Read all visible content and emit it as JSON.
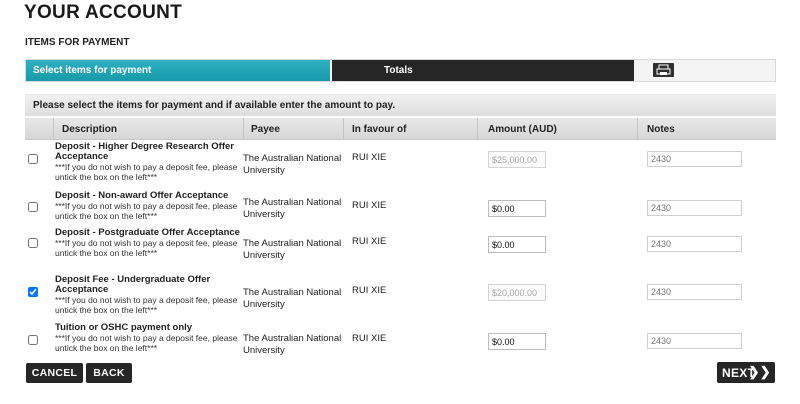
{
  "page": {
    "title": "YOUR ACCOUNT",
    "section_title": "ITEMS FOR PAYMENT"
  },
  "steps": {
    "select_label": "Select items for payment",
    "totals_label": "Totals",
    "print_icon": "printer-icon"
  },
  "instruction": "Please select the items for payment and if available enter the amount to pay.",
  "table": {
    "headers": {
      "description": "Description",
      "payee": "Payee",
      "favour": "In favour of",
      "amount": "Amount (AUD)",
      "notes": "Notes"
    },
    "rows": [
      {
        "checked": false,
        "title": "Deposit - Higher Degree Research Offer Acceptance",
        "note": "***If you do not wish to pay a deposit fee, please untick the box on the left***",
        "payee": "The Australian National University",
        "favour": "RUI XIE",
        "amount": "$25,000.00",
        "amount_editable": false,
        "notes": "2430"
      },
      {
        "checked": false,
        "title": "Deposit - Non-award Offer Acceptance",
        "note": "***If you do not wish to pay a deposit fee, please untick the box on the left***",
        "payee": "The Australian National University",
        "favour": "RUI XIE",
        "amount": "$0.00",
        "amount_editable": true,
        "notes": "2430"
      },
      {
        "checked": false,
        "title": "Deposit - Postgraduate Offer Acceptance",
        "note": "***If you do not wish to pay a deposit fee, please untick the box on the left***",
        "payee": "The Australian National University",
        "favour": "RUI XIE",
        "amount": "$0.00",
        "amount_editable": true,
        "notes": "2430"
      },
      {
        "checked": true,
        "title": "Deposit Fee - Undergraduate Offer Acceptance",
        "note": "***If you do not wish to pay a deposit fee, please untick the box on the left***",
        "payee": "The Australian National University",
        "favour": "RUI XIE",
        "amount": "$20,000.00",
        "amount_editable": false,
        "notes": "2430"
      },
      {
        "checked": false,
        "title": "Tuition or OSHC payment only",
        "note": "***If you do not wish to pay a deposit fee, please untick the box on the left***",
        "payee": "The Australian National University",
        "favour": "RUI XIE",
        "amount": "$0.00",
        "amount_editable": true,
        "notes": "2430"
      }
    ]
  },
  "buttons": {
    "cancel": "CANCEL",
    "back": "BACK",
    "next": "NEXT",
    "next_icon": "double-chevron-right-icon"
  },
  "colors": {
    "step_active": "#1ea5b5",
    "step_dark": "#262626",
    "button_dark": "#262626"
  }
}
